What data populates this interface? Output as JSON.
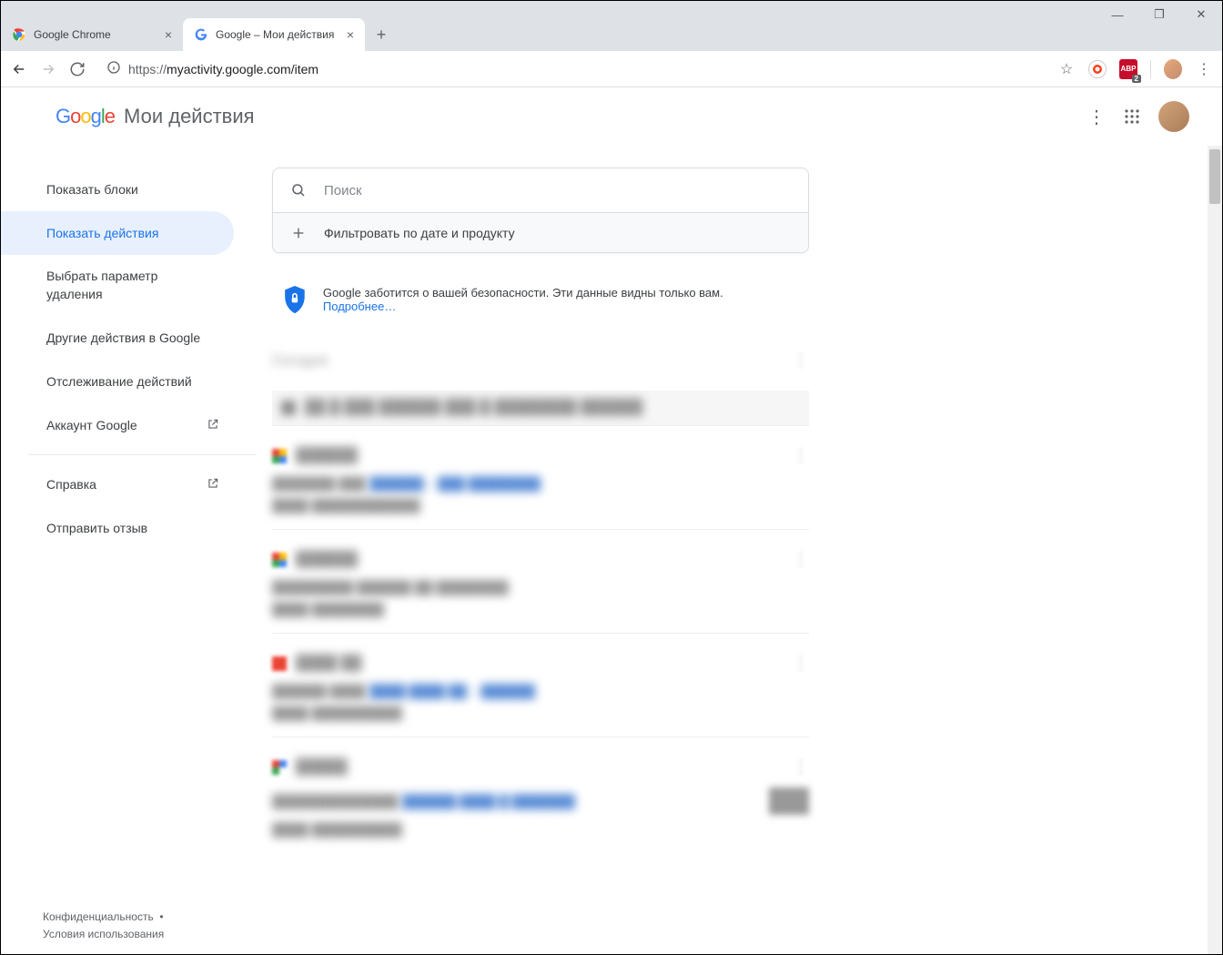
{
  "browser": {
    "tabs": [
      {
        "title": "Google Chrome",
        "active": false
      },
      {
        "title": "Google – Мои действия",
        "active": true
      }
    ],
    "url": {
      "proto": "https://",
      "rest": "myactivity.google.com/item"
    },
    "abp_badge": "2"
  },
  "header": {
    "logo": "Google",
    "title": "Мои действия"
  },
  "sidebar": {
    "items": [
      {
        "label": "Показать блоки"
      },
      {
        "label": "Показать действия"
      },
      {
        "label": "Выбрать параметр удаления"
      },
      {
        "label": "Другие действия в Google"
      },
      {
        "label": "Отслеживание действий"
      },
      {
        "label": "Аккаунт Google"
      },
      {
        "label": "Справка"
      },
      {
        "label": "Отправить отзыв"
      }
    ]
  },
  "footer": {
    "privacy": "Конфиденциальность",
    "dot": "•",
    "terms": "Условия использования"
  },
  "search": {
    "placeholder": "Поиск",
    "filter": "Фильтровать по дате и продукту"
  },
  "banner": {
    "text": "Google заботится о вашей безопасности. Эти данные видны только вам. ",
    "link": "Подробнее…"
  }
}
